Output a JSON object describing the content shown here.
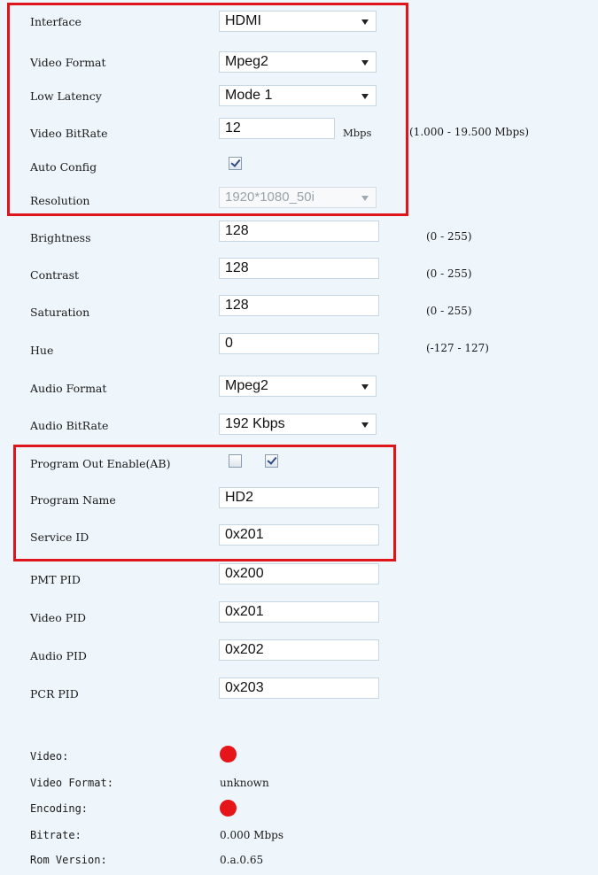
{
  "fields": {
    "interface": {
      "label": "Interface",
      "value": "HDMI"
    },
    "video_format": {
      "label": "Video Format",
      "value": "Mpeg2"
    },
    "low_latency": {
      "label": "Low Latency",
      "value": "Mode 1"
    },
    "video_bitrate": {
      "label": "Video BitRate",
      "value": "12",
      "unit": "Mbps",
      "range": "(1.000 - 19.500 Mbps)"
    },
    "auto_config": {
      "label": "Auto Config",
      "checked": true
    },
    "resolution": {
      "label": "Resolution",
      "value": "1920*1080_50i",
      "disabled": true
    },
    "brightness": {
      "label": "Brightness",
      "value": "128",
      "range": "(0 - 255)"
    },
    "contrast": {
      "label": "Contrast",
      "value": "128",
      "range": "(0 - 255)"
    },
    "saturation": {
      "label": "Saturation",
      "value": "128",
      "range": "(0 - 255)"
    },
    "hue": {
      "label": "Hue",
      "value": "0",
      "range": "(-127 - 127)"
    },
    "audio_format": {
      "label": "Audio Format",
      "value": "Mpeg2"
    },
    "audio_bitrate": {
      "label": "Audio BitRate",
      "value": "192 Kbps"
    },
    "program_out_enable": {
      "label": "Program Out Enable(AB)",
      "a_checked": false,
      "b_checked": true
    },
    "program_name": {
      "label": "Program Name",
      "value": "HD2"
    },
    "service_id": {
      "label": "Service ID",
      "value": "0x201"
    },
    "pmt_pid": {
      "label": "PMT PID",
      "value": "0x200"
    },
    "video_pid": {
      "label": "Video PID",
      "value": "0x201"
    },
    "audio_pid": {
      "label": "Audio PID",
      "value": "0x202"
    },
    "pcr_pid": {
      "label": "PCR PID",
      "value": "0x203"
    }
  },
  "status": {
    "video": {
      "label": "Video:",
      "indicator_color": "#e5151a"
    },
    "video_format": {
      "label": "Video Format:",
      "value": "unknown"
    },
    "encoding": {
      "label": "Encoding:",
      "indicator_color": "#e5151a"
    },
    "bitrate": {
      "label": "Bitrate:",
      "value": "0.000 Mbps"
    },
    "rom_version": {
      "label": "Rom Version:",
      "value": "0.a.0.65"
    }
  },
  "colors": {
    "highlight_box": "#e0141b",
    "background": "#eef5fb"
  }
}
